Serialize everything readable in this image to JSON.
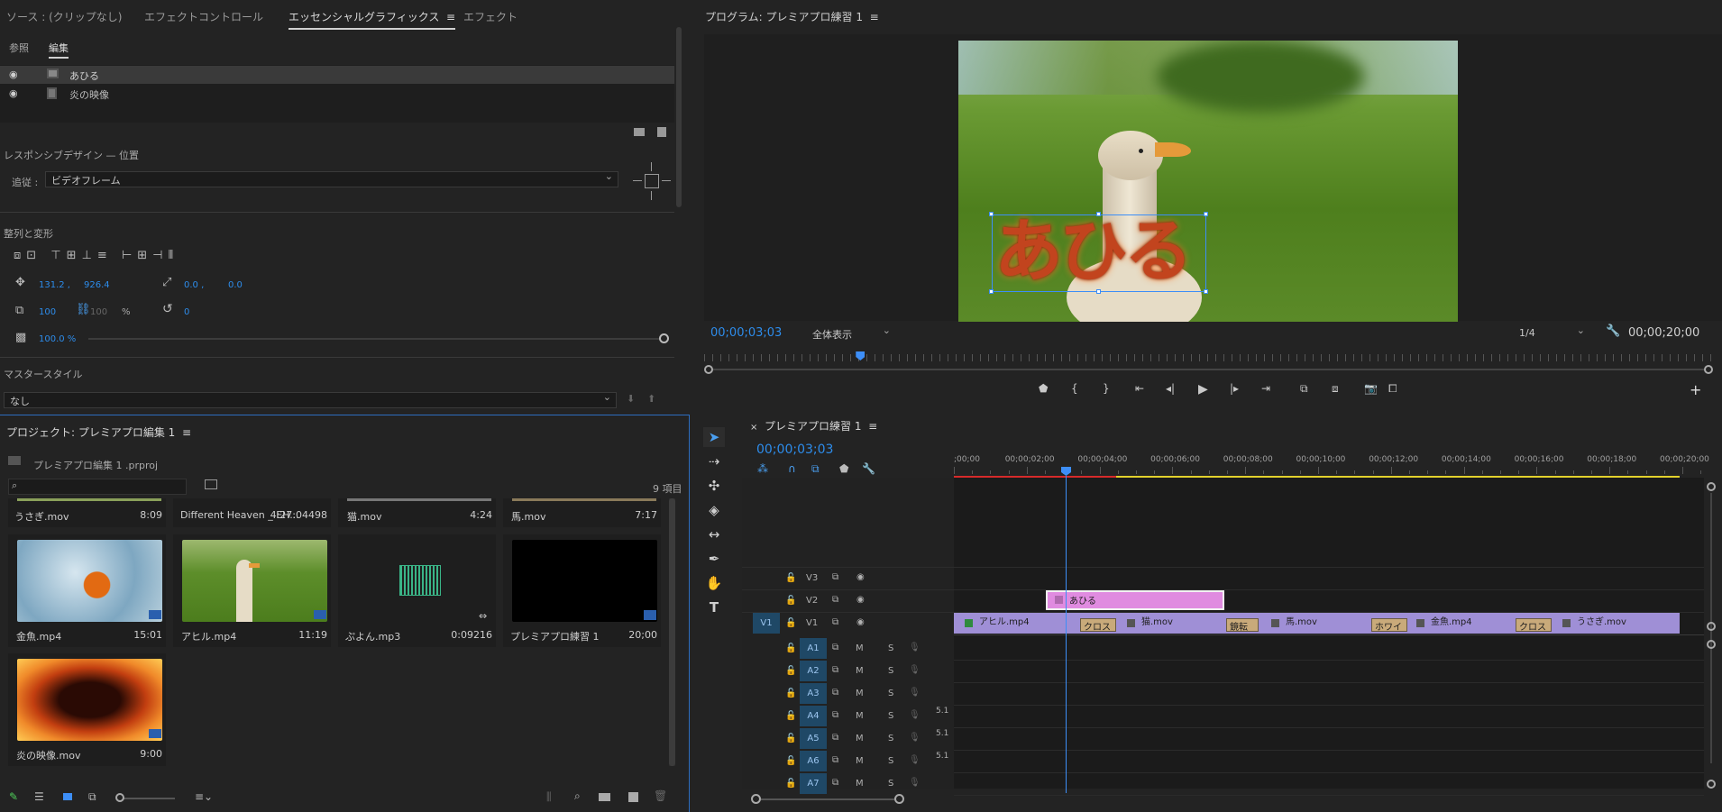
{
  "top_left_tabs": {
    "source": "ソース : (クリップなし)",
    "effect_controls": "エフェクトコントロール",
    "essential_graphics": "エッセンシャルグラフィックス",
    "effects": "エフェクト"
  },
  "eg": {
    "subtabs": {
      "browse": "参照",
      "edit": "編集"
    },
    "layers": [
      {
        "label": "あひる"
      },
      {
        "label": "炎の映像"
      }
    ],
    "responsive_title": "レスポンシブデザイン — 位置",
    "follow_label": "追従 :",
    "follow_value": "ビデオフレーム",
    "align_title": "整列と変形",
    "pos_x": "131.2 ,",
    "pos_y": "926.4",
    "anchor_x": "0.0 ,",
    "anchor_y": "0.0",
    "scale_w": "100",
    "scale_h": "100",
    "scale_unit": "%",
    "rotation": "0",
    "opacity": "100.0 %",
    "master_title": "マスタースタイル",
    "master_value": "なし"
  },
  "program": {
    "title": "プログラム: プレミアプロ練習 1",
    "timecode": "00;00;03;03",
    "fit": "全体表示",
    "resolution": "1/4",
    "duration": "00;00;20;00",
    "title_text": "あひる",
    "playhead_fraction": 0.155
  },
  "project": {
    "title": "プロジェクト: プレミアプロ編集 1",
    "file": "プレミアプロ編集 1 .prproj",
    "count": "9 項目",
    "items_top": [
      {
        "name": "うさぎ.mov",
        "dur": "8:09"
      },
      {
        "name": "Different Heaven _ EH...",
        "dur": "4:27:04498"
      },
      {
        "name": "猫.mov",
        "dur": "4:24"
      },
      {
        "name": "馬.mov",
        "dur": "7:17"
      }
    ],
    "items": [
      {
        "name": "金魚.mp4",
        "dur": "15:01"
      },
      {
        "name": "アヒル.mp4",
        "dur": "11:19"
      },
      {
        "name": "ぷよん.mp3",
        "dur": "0:09216"
      },
      {
        "name": "プレミアプロ練習 1",
        "dur": "20;00"
      },
      {
        "name": "炎の映像.mov",
        "dur": "9:00"
      }
    ]
  },
  "timeline": {
    "title": "プレミアプロ練習 1",
    "timecode": "00;00;03;03",
    "ruler": [
      ";00;00",
      "00;00;02;00",
      "00;00;04;00",
      "00;00;06;00",
      "00;00;08;00",
      "00;00;10;00",
      "00;00;12;00",
      "00;00;14;00",
      "00;00;16;00",
      "00;00;18;00",
      "00;00;20;00"
    ],
    "video_tracks": [
      "V3",
      "V2",
      "V1"
    ],
    "audio_tracks": [
      "A1",
      "A2",
      "A3",
      "A4",
      "A5",
      "A6",
      "A7"
    ],
    "src_patch": "V1",
    "m": "M",
    "s": "S",
    "ch51": "5.1",
    "v2_clip": "あひる",
    "v1_clips": [
      "アヒル.mp4",
      "猫.mov",
      "馬.mov",
      "金魚.mp4",
      "うさぎ.mov"
    ],
    "transitions": [
      "クロス",
      "鏡転",
      "ホワイ",
      "クロス"
    ]
  },
  "colors": {
    "accent": "#2d8ceb",
    "title_clip": "#e08be0",
    "video_clip": "#9f8fd6",
    "transition": "#c9aa7a"
  }
}
